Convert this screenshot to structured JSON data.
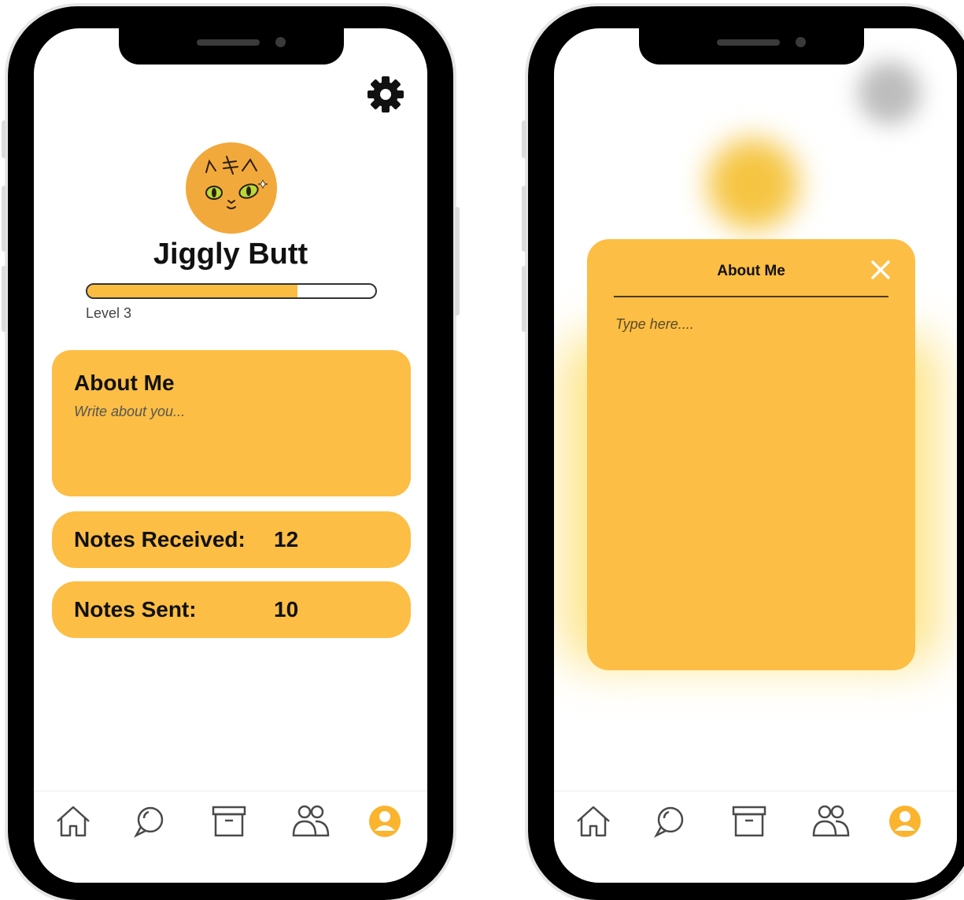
{
  "left_screen": {
    "profile": {
      "username": "Jiggly Butt",
      "level_label": "Level 3",
      "level_progress": 0.73
    },
    "about_card": {
      "title": "About Me",
      "placeholder": "Write about you..."
    },
    "stats": [
      {
        "label": "Notes Received:",
        "value": "12"
      },
      {
        "label": "Notes Sent:",
        "value": "10"
      }
    ]
  },
  "right_screen": {
    "modal": {
      "title": "About Me",
      "input_placeholder": "Type here...."
    }
  },
  "nav": {
    "items": [
      "home-icon",
      "chat-icon",
      "archive-icon",
      "friends-icon",
      "profile-icon"
    ],
    "active": "profile-icon"
  },
  "colors": {
    "accent": "#fcbe44",
    "avatar_bg": "#f2a93b",
    "nav_active": "#fbb42e",
    "nav_inactive": "#4a4a4a"
  }
}
